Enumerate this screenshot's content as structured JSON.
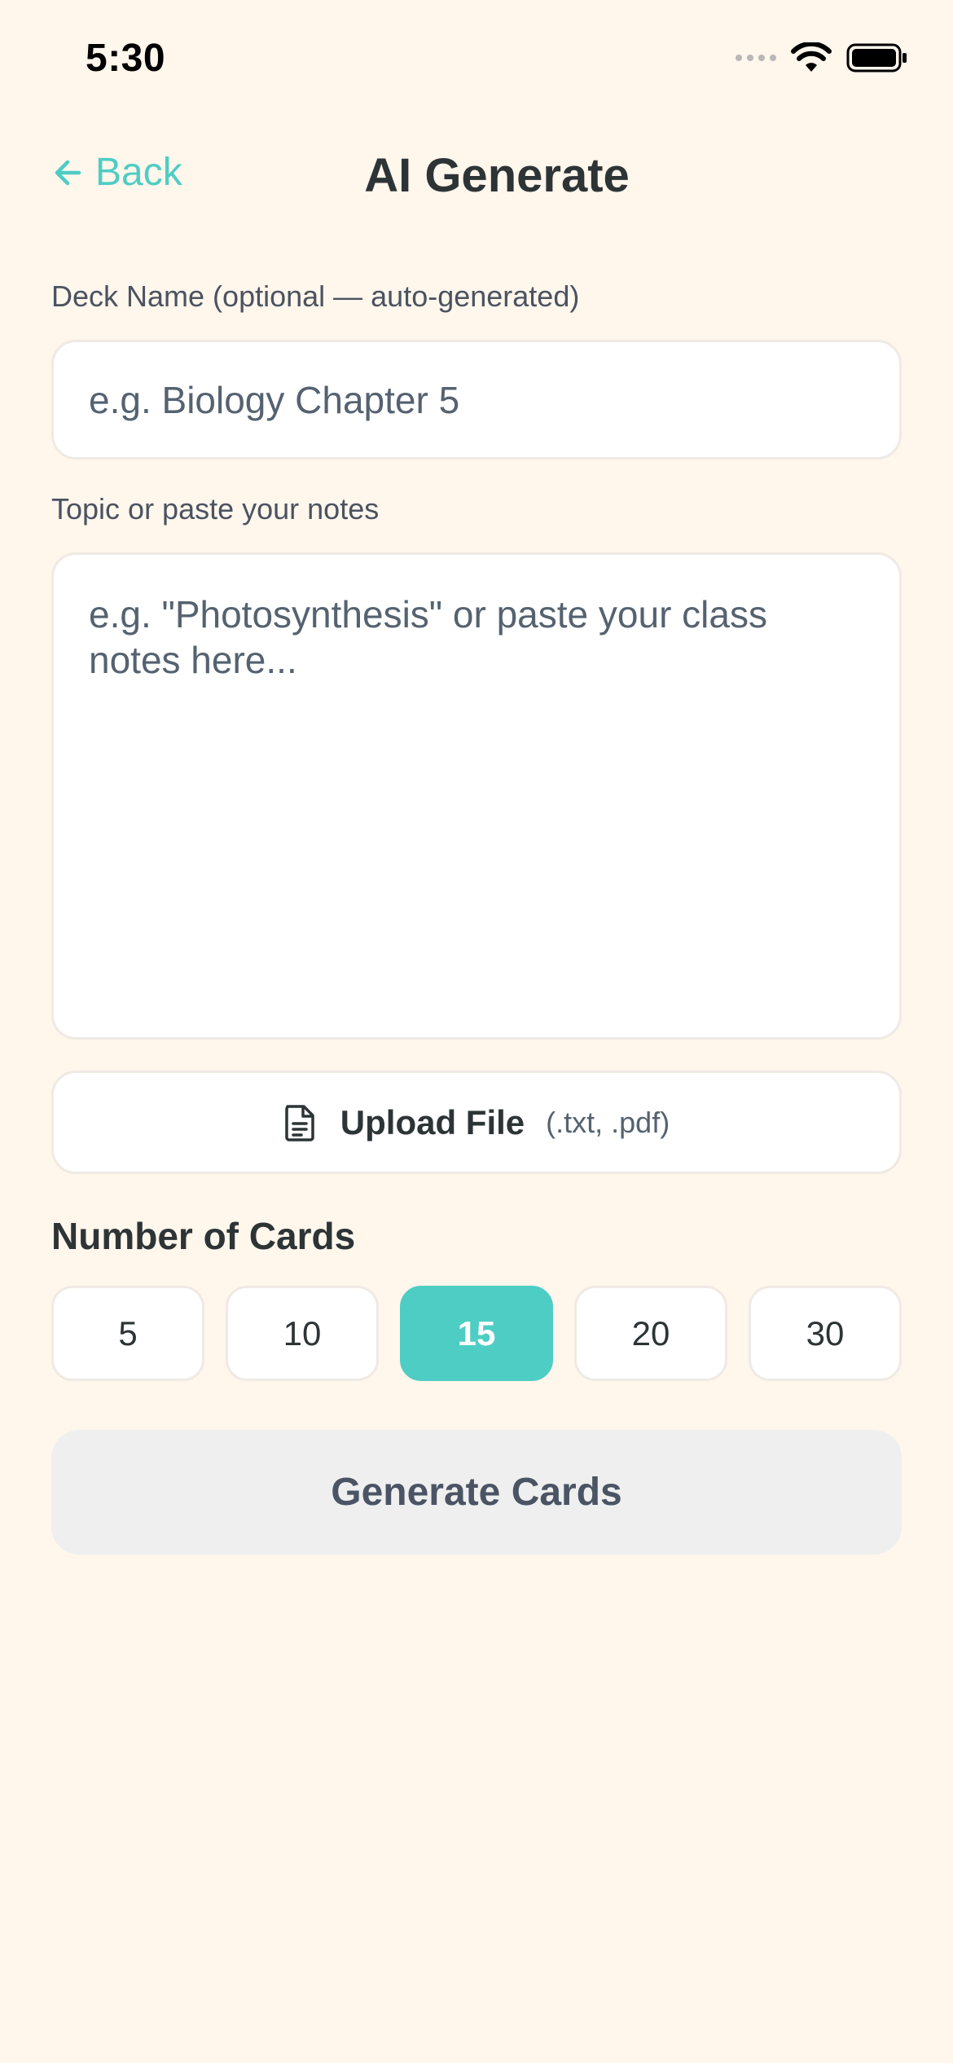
{
  "status_bar": {
    "time": "5:30",
    "icons": [
      "cellular-signal-icon",
      "wifi-icon",
      "battery-icon"
    ]
  },
  "header": {
    "back_label": "Back",
    "back_icon": "arrow-left-icon",
    "title": "AI Generate"
  },
  "form": {
    "deck_name": {
      "label": "Deck Name (optional — auto-generated)",
      "value": "",
      "placeholder": "e.g. Biology Chapter 5"
    },
    "notes": {
      "label": "Topic or paste your notes",
      "value": "",
      "placeholder": "e.g. \"Photosynthesis\" or paste your class notes here..."
    },
    "upload": {
      "icon": "document-icon",
      "label": "Upload File",
      "hint": "(.txt, .pdf)"
    }
  },
  "card_count": {
    "title": "Number of Cards",
    "options": [
      "5",
      "10",
      "15",
      "20",
      "30"
    ],
    "selected": "15"
  },
  "generate_button": {
    "label": "Generate Cards"
  },
  "colors": {
    "background": "#FFF6EC",
    "accent": "#4ECDC4",
    "text_primary": "#2D3436",
    "button_disabled": "#EFEFEF"
  }
}
